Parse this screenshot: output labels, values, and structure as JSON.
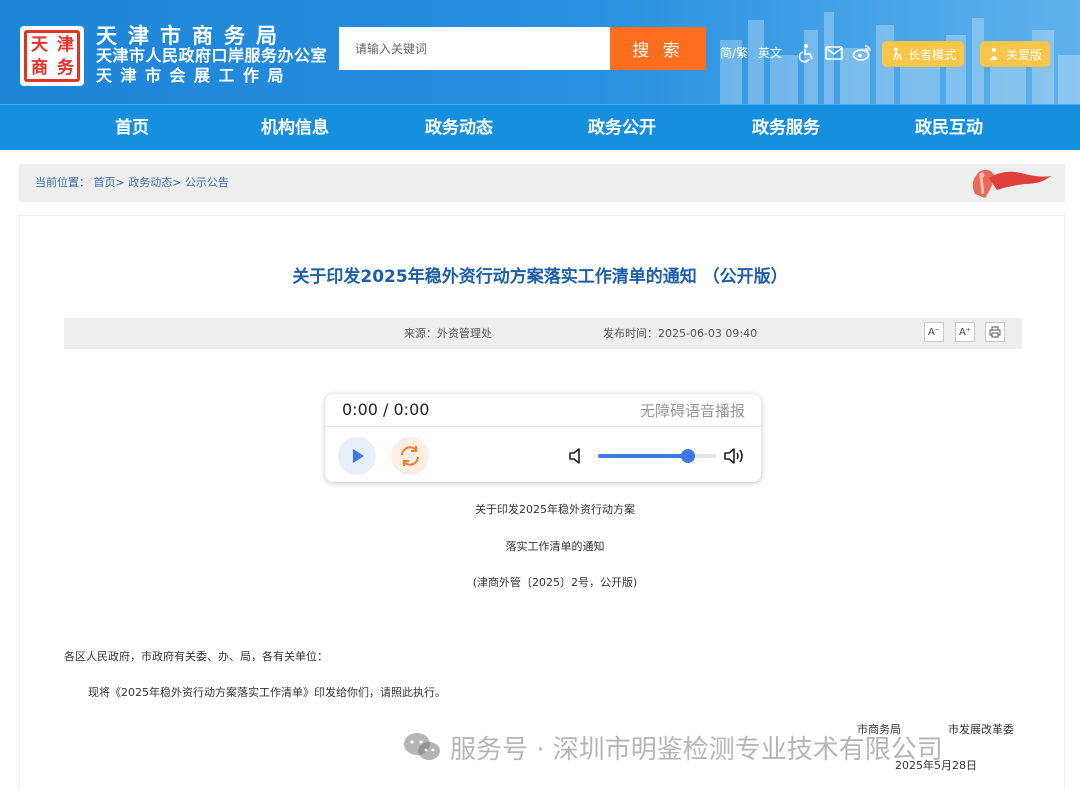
{
  "header": {
    "logo_chars": [
      "天",
      "津",
      "商",
      "务"
    ],
    "org_line1": "天津市商务局",
    "org_line2": "天津市人民政府口岸服务办公室",
    "org_line3": "天津市会展工作局",
    "search_placeholder": "请输入关键词",
    "search_button": "搜 索",
    "lang_simp_trad": "简/繁",
    "lang_english": "英文",
    "elder_mode": "长者模式",
    "care_version": "关爱版"
  },
  "nav": {
    "items": [
      "首页",
      "机构信息",
      "政务动态",
      "政务公开",
      "政务服务",
      "政民互动"
    ]
  },
  "breadcrumb": {
    "prefix": "当前位置：",
    "items": [
      "首页>",
      "政务动态>",
      "公示公告"
    ]
  },
  "article": {
    "title": "关于印发2025年稳外资行动方案落实工作清单的通知 （公开版）",
    "source": "来源：外资管理处",
    "publish_time": "发布时间：2025-06-03 09:40",
    "font_decrease": "A⁻",
    "font_increase": "A⁺",
    "doc_title_1": "关于印发2025年稳外资行动方案",
    "doc_title_2": "落实工作清单的通知",
    "doc_number": "(津商外管〔2025〕2号，公开版)",
    "salutation": "各区人民政府，市政府有关委、办、局，各有关单位：",
    "body_p1": "现将《2025年稳外资行动方案落实工作清单》印发给你们，请照此执行。",
    "signer_1": "市商务局",
    "signer_2": "市发展改革委",
    "date": "2025年5月28日"
  },
  "audio_player": {
    "time": "0:00 / 0:00",
    "label": "无障碍语音播报",
    "volume_fraction": 0.76
  },
  "watermark": {
    "text": "服务号 · 深圳市明鉴检测专业技术有限公司"
  },
  "colors": {
    "header_blue": "#1e84d8",
    "nav_blue": "#168fde",
    "search_orange": "#ff6d1f",
    "pill_yellow": "#f9c64a",
    "title_blue": "#1a5fa8",
    "player_blue": "#3e78e6"
  }
}
